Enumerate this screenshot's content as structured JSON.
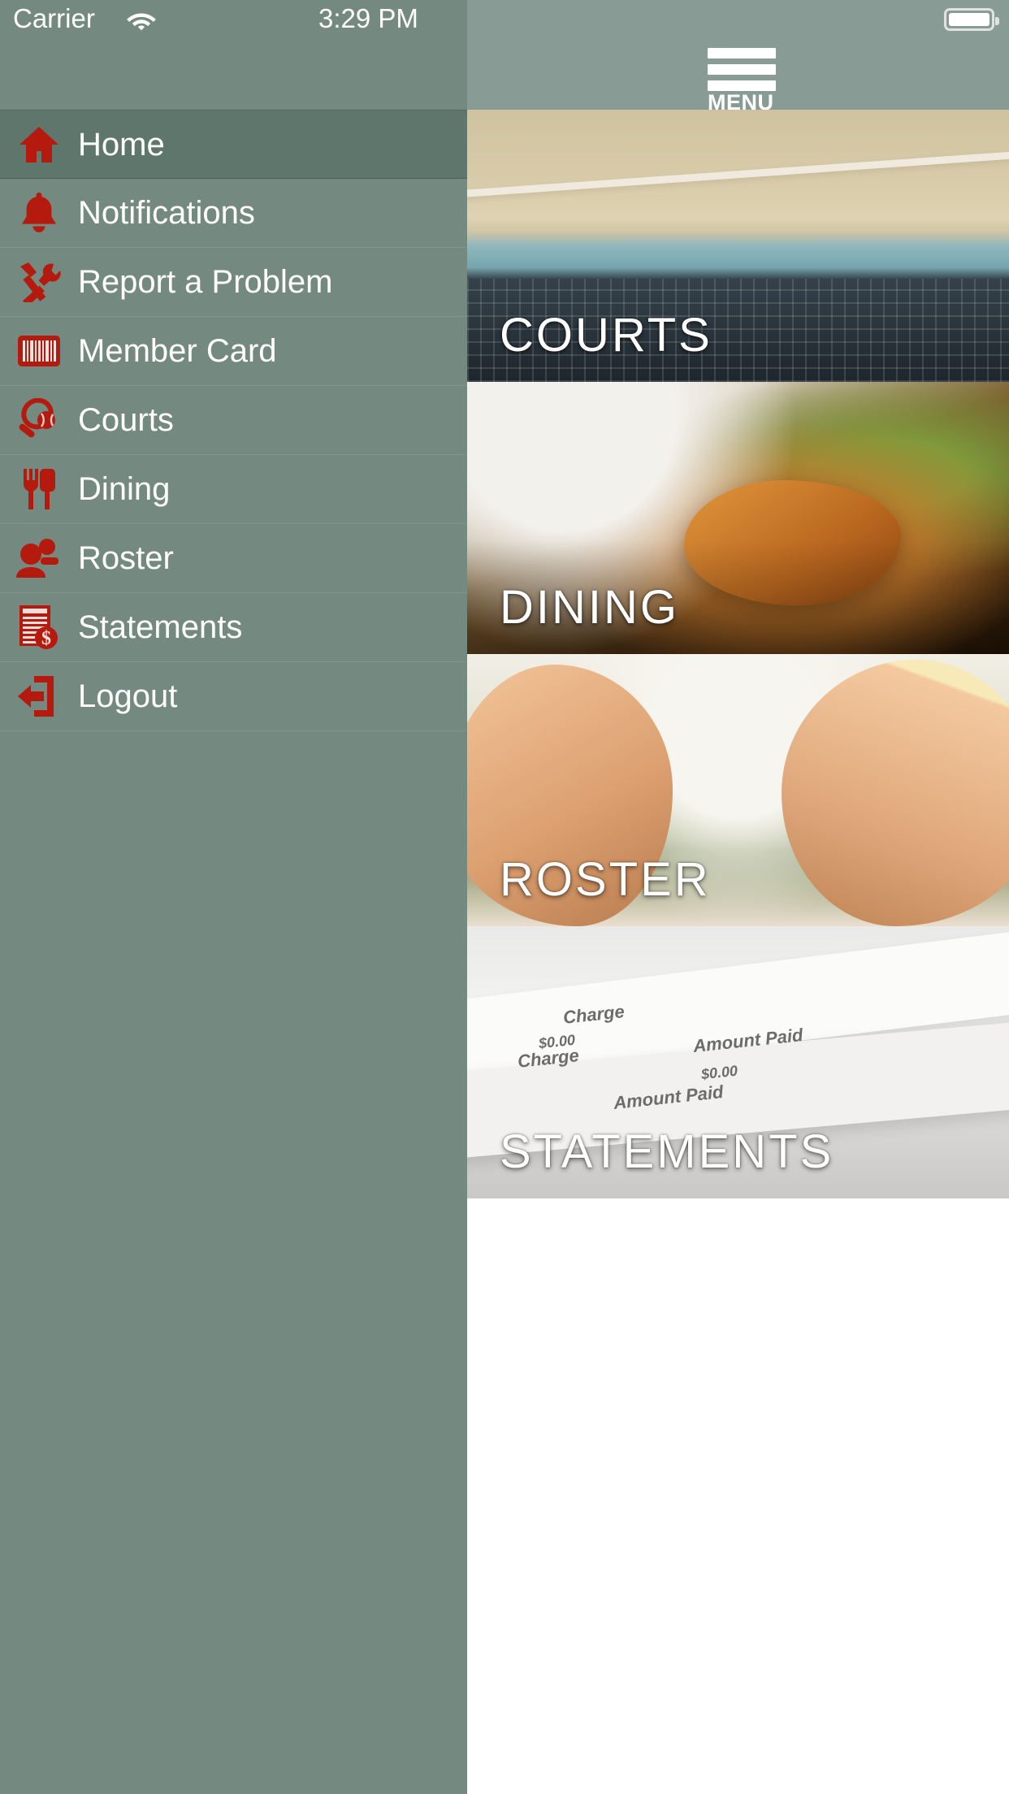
{
  "status_bar": {
    "carrier": "Carrier",
    "wifi_icon": "wifi-icon",
    "time": "3:29 PM",
    "battery_icon": "battery-icon"
  },
  "header": {
    "menu_label": "MENU",
    "menu_icon": "hamburger-menu-icon"
  },
  "sidebar": {
    "background_color": "#748a81",
    "active_color": "#5f766d",
    "icon_color": "#b51a0e",
    "items": [
      {
        "label": "Home",
        "icon": "home-icon",
        "active": true
      },
      {
        "label": "Notifications",
        "icon": "bell-icon",
        "active": false
      },
      {
        "label": "Report a Problem",
        "icon": "tools-icon",
        "active": false
      },
      {
        "label": "Member Card",
        "icon": "barcode-icon",
        "active": false
      },
      {
        "label": "Courts",
        "icon": "tennis-racquet-icon",
        "active": false
      },
      {
        "label": "Dining",
        "icon": "fork-knife-icon",
        "active": false
      },
      {
        "label": "Roster",
        "icon": "people-icon",
        "active": false
      },
      {
        "label": "Statements",
        "icon": "document-dollar-icon",
        "active": false
      },
      {
        "label": "Logout",
        "icon": "logout-icon",
        "active": false
      }
    ]
  },
  "main": {
    "cards": [
      {
        "label": "COURTS",
        "photo": "tennis-court-photo"
      },
      {
        "label": "DINING",
        "photo": "plated-food-photo"
      },
      {
        "label": "ROSTER",
        "photo": "smiling-couple-photo"
      },
      {
        "label": "STATEMENTS",
        "photo": "statements-paper-photo"
      }
    ],
    "statement_paper_text": {
      "charge_1": "Charge",
      "amount_1": "$0.00",
      "paid_1": "Amount Paid",
      "paid_amount_1": "$0.00",
      "charge_2": "Charge",
      "amount_2": "$0.00",
      "paid_2": "Amount Paid"
    }
  }
}
